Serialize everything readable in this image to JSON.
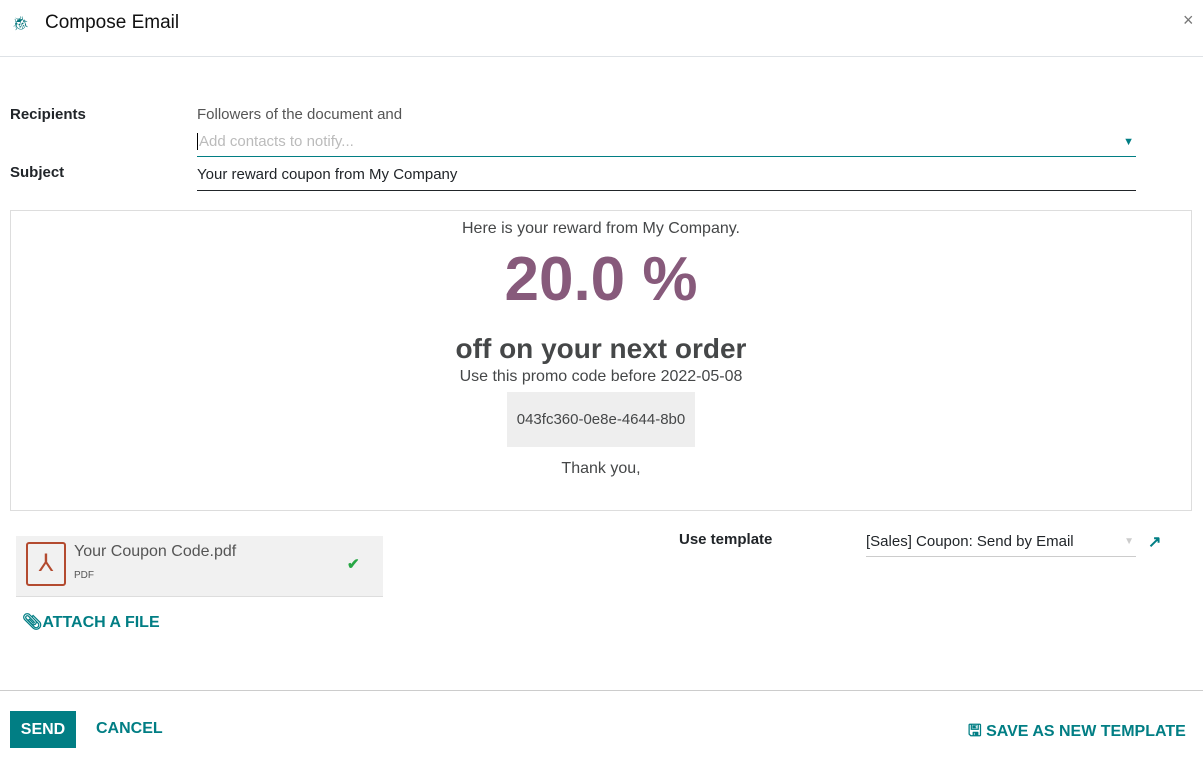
{
  "dialog": {
    "title": "Compose Email",
    "icon": "bug-icon",
    "close": "×"
  },
  "form": {
    "recipients_label": "Recipients",
    "followers_text": "Followers of the document and",
    "contacts_placeholder": "Add contacts to notify...",
    "subject_label": "Subject",
    "subject_value": "Your reward coupon from My Company"
  },
  "email_body": {
    "intro": "Here is your reward from My Company.",
    "discount": "20.0 %",
    "offer": "off on your next order",
    "promo_text": "Use this promo code before 2022-05-08",
    "code": "043fc360-0e8e-4644-8b0",
    "thanks": "Thank you,"
  },
  "attachment": {
    "name": "Your Coupon Code.pdf",
    "type": "PDF",
    "attach_label": "ATTACH A FILE"
  },
  "template": {
    "label": "Use template",
    "value": "[Sales] Coupon: Send by Email"
  },
  "footer": {
    "send": "SEND",
    "cancel": "CANCEL",
    "save_template": "SAVE AS NEW TEMPLATE"
  },
  "colors": {
    "accent": "#017e84",
    "discount": "#875a7b"
  }
}
